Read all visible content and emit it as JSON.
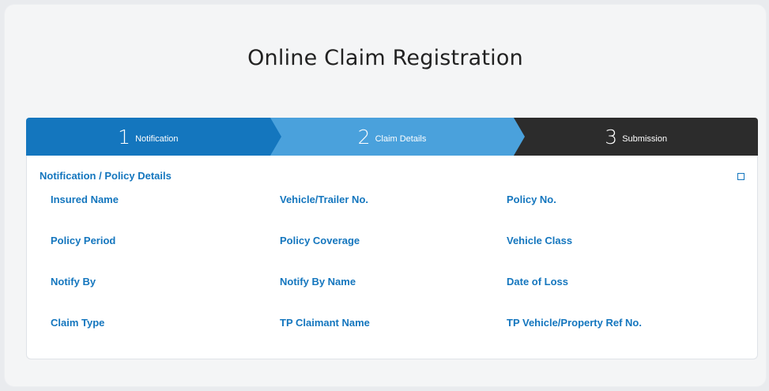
{
  "page": {
    "title": "Online Claim Registration"
  },
  "wizard": {
    "steps": [
      {
        "number": "1",
        "label": "Notification",
        "color": "#1476be"
      },
      {
        "number": "2",
        "label": "Claim Details",
        "color": "#4aa1dc"
      },
      {
        "number": "3",
        "label": "Submission",
        "color": "#2c2c2c"
      }
    ]
  },
  "section": {
    "title": "Notification / Policy Details",
    "expand_icon": "square-outline-icon",
    "fields": [
      "Insured Name",
      "Vehicle/Trailer No.",
      "Policy No.",
      "Policy Period",
      "Policy Coverage",
      "Vehicle Class",
      "Notify By",
      "Notify By Name",
      "Date of Loss",
      "Claim Type",
      "TP Claimant Name",
      "TP Vehicle/Property Ref No."
    ]
  },
  "colors": {
    "accent": "#1476be",
    "accent_light": "#4aa1dc",
    "dark_step": "#2c2c2c"
  }
}
